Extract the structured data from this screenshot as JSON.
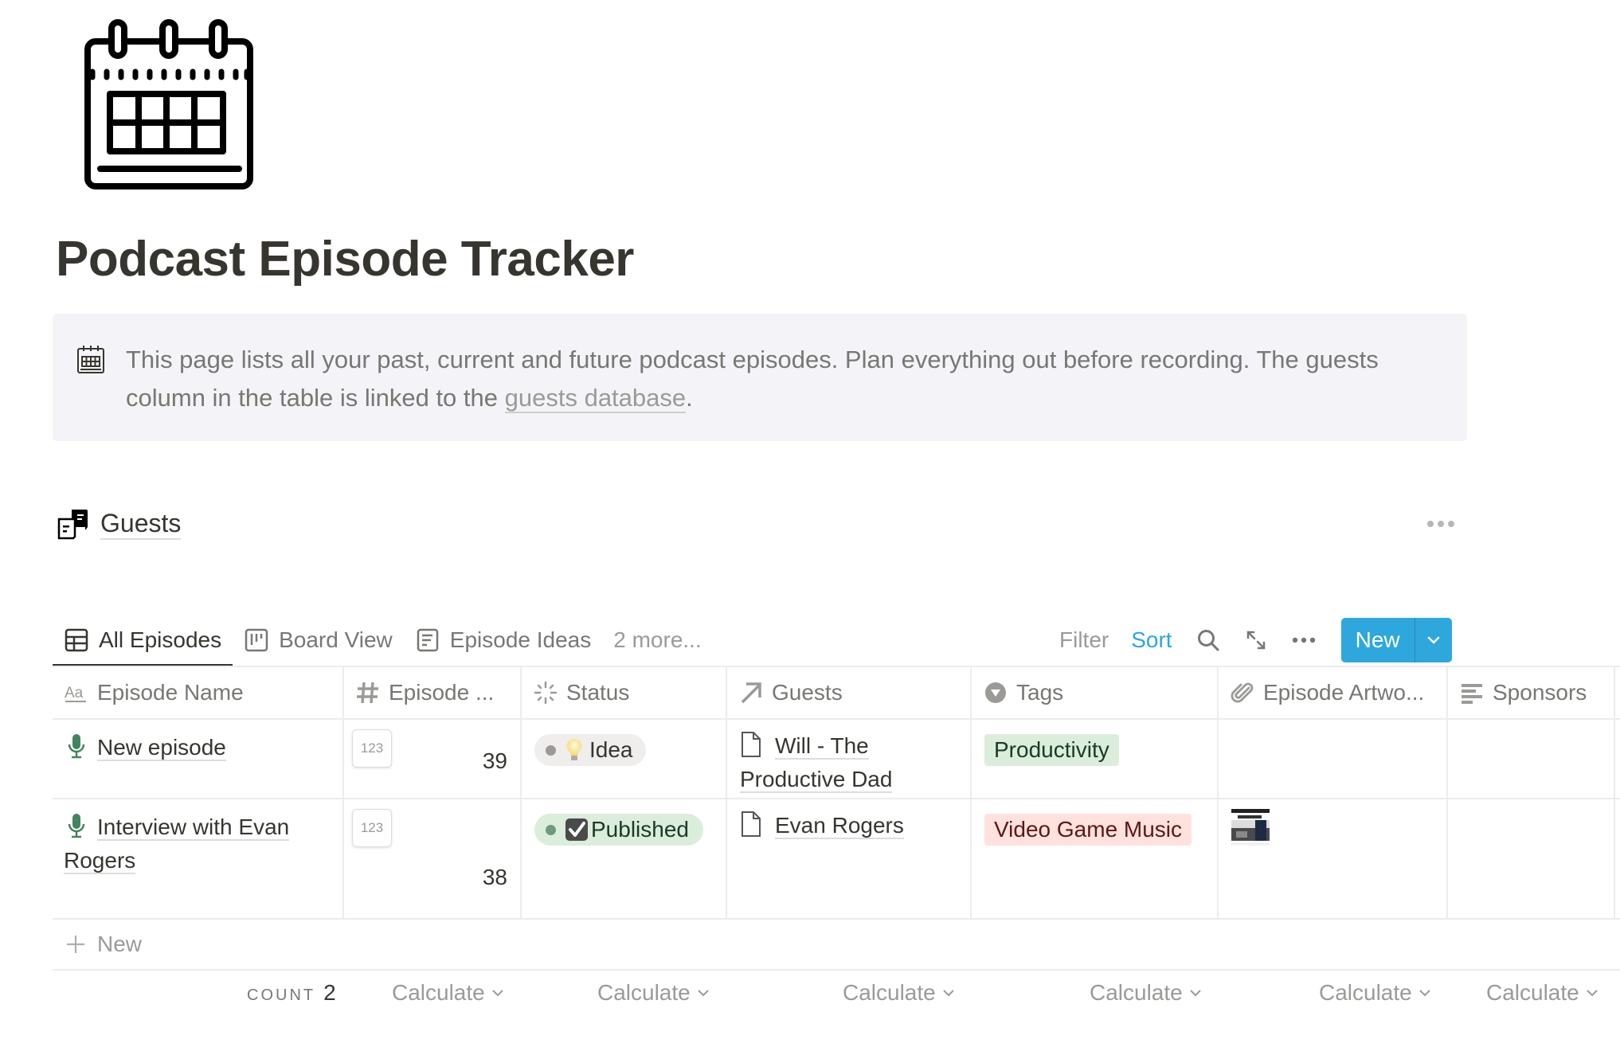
{
  "page": {
    "icon": "calendar-icon",
    "title": "Podcast Episode Tracker"
  },
  "callout": {
    "icon": "calendar-icon",
    "text": "This page lists all your past, current and future podcast episodes. Plan everything out before recording. The guests column in the table is linked to the ",
    "link_text": "guests database",
    "text_after": "."
  },
  "database": {
    "icon": "chat-documents-icon",
    "title": "Guests",
    "more_icon": "more-horizontal-icon"
  },
  "views": {
    "tabs": [
      {
        "label": "All Episodes",
        "icon": "table-icon",
        "active": true
      },
      {
        "label": "Board View",
        "icon": "board-icon",
        "active": false
      },
      {
        "label": "Episode Ideas",
        "icon": "list-icon",
        "active": false
      }
    ],
    "more_label": "2 more..."
  },
  "toolbar": {
    "filter_label": "Filter",
    "sort_label": "Sort",
    "search_icon": "search-icon",
    "expand_icon": "expand-icon",
    "more_icon": "more-horizontal-icon",
    "new_label": "New",
    "new_caret_icon": "chevron-down-icon",
    "accent_color": "#2ea7dc"
  },
  "table": {
    "columns": [
      {
        "label": "Episode Name",
        "icon": "text-icon"
      },
      {
        "label": "Episode ...",
        "icon": "hash-icon"
      },
      {
        "label": "Status",
        "icon": "status-icon"
      },
      {
        "label": "Guests",
        "icon": "relation-arrow-icon"
      },
      {
        "label": "Tags",
        "icon": "select-icon"
      },
      {
        "label": "Episode Artwo...",
        "icon": "paperclip-icon"
      },
      {
        "label": "Sponsors",
        "icon": "text-lines-icon"
      }
    ],
    "rows": [
      {
        "name": "New episode",
        "name_icon": "microphone-icon",
        "episode_number_icon": "123",
        "episode_number": "39",
        "status": {
          "label": "Idea",
          "emoji": "lightbulb-icon",
          "bg": "#efeeed",
          "dot": "#9b9a97",
          "text": "#37352f"
        },
        "guests": "Will - The Productive Dad",
        "tag": {
          "label": "Productivity",
          "bg": "#dbeddb",
          "text": "#1c3829"
        },
        "artwork": false,
        "sponsors": ""
      },
      {
        "name": "Interview with Evan Rogers",
        "name_icon": "microphone-icon",
        "episode_number_icon": "123",
        "episode_number": "38",
        "status": {
          "label": "Published",
          "emoji": "checkbox-checked-icon",
          "bg": "#dbeddb",
          "dot": "#6c9b7d",
          "text": "#1c3829"
        },
        "guests": "Evan Rogers",
        "tag": {
          "label": "Video Game Music",
          "bg": "#ffe2dd",
          "text": "#5d1715"
        },
        "artwork": true,
        "sponsors": ""
      }
    ],
    "new_row_label": "New"
  },
  "footer": {
    "count_label": "COUNT",
    "count_value": "2",
    "calculate_label": "Calculate"
  }
}
